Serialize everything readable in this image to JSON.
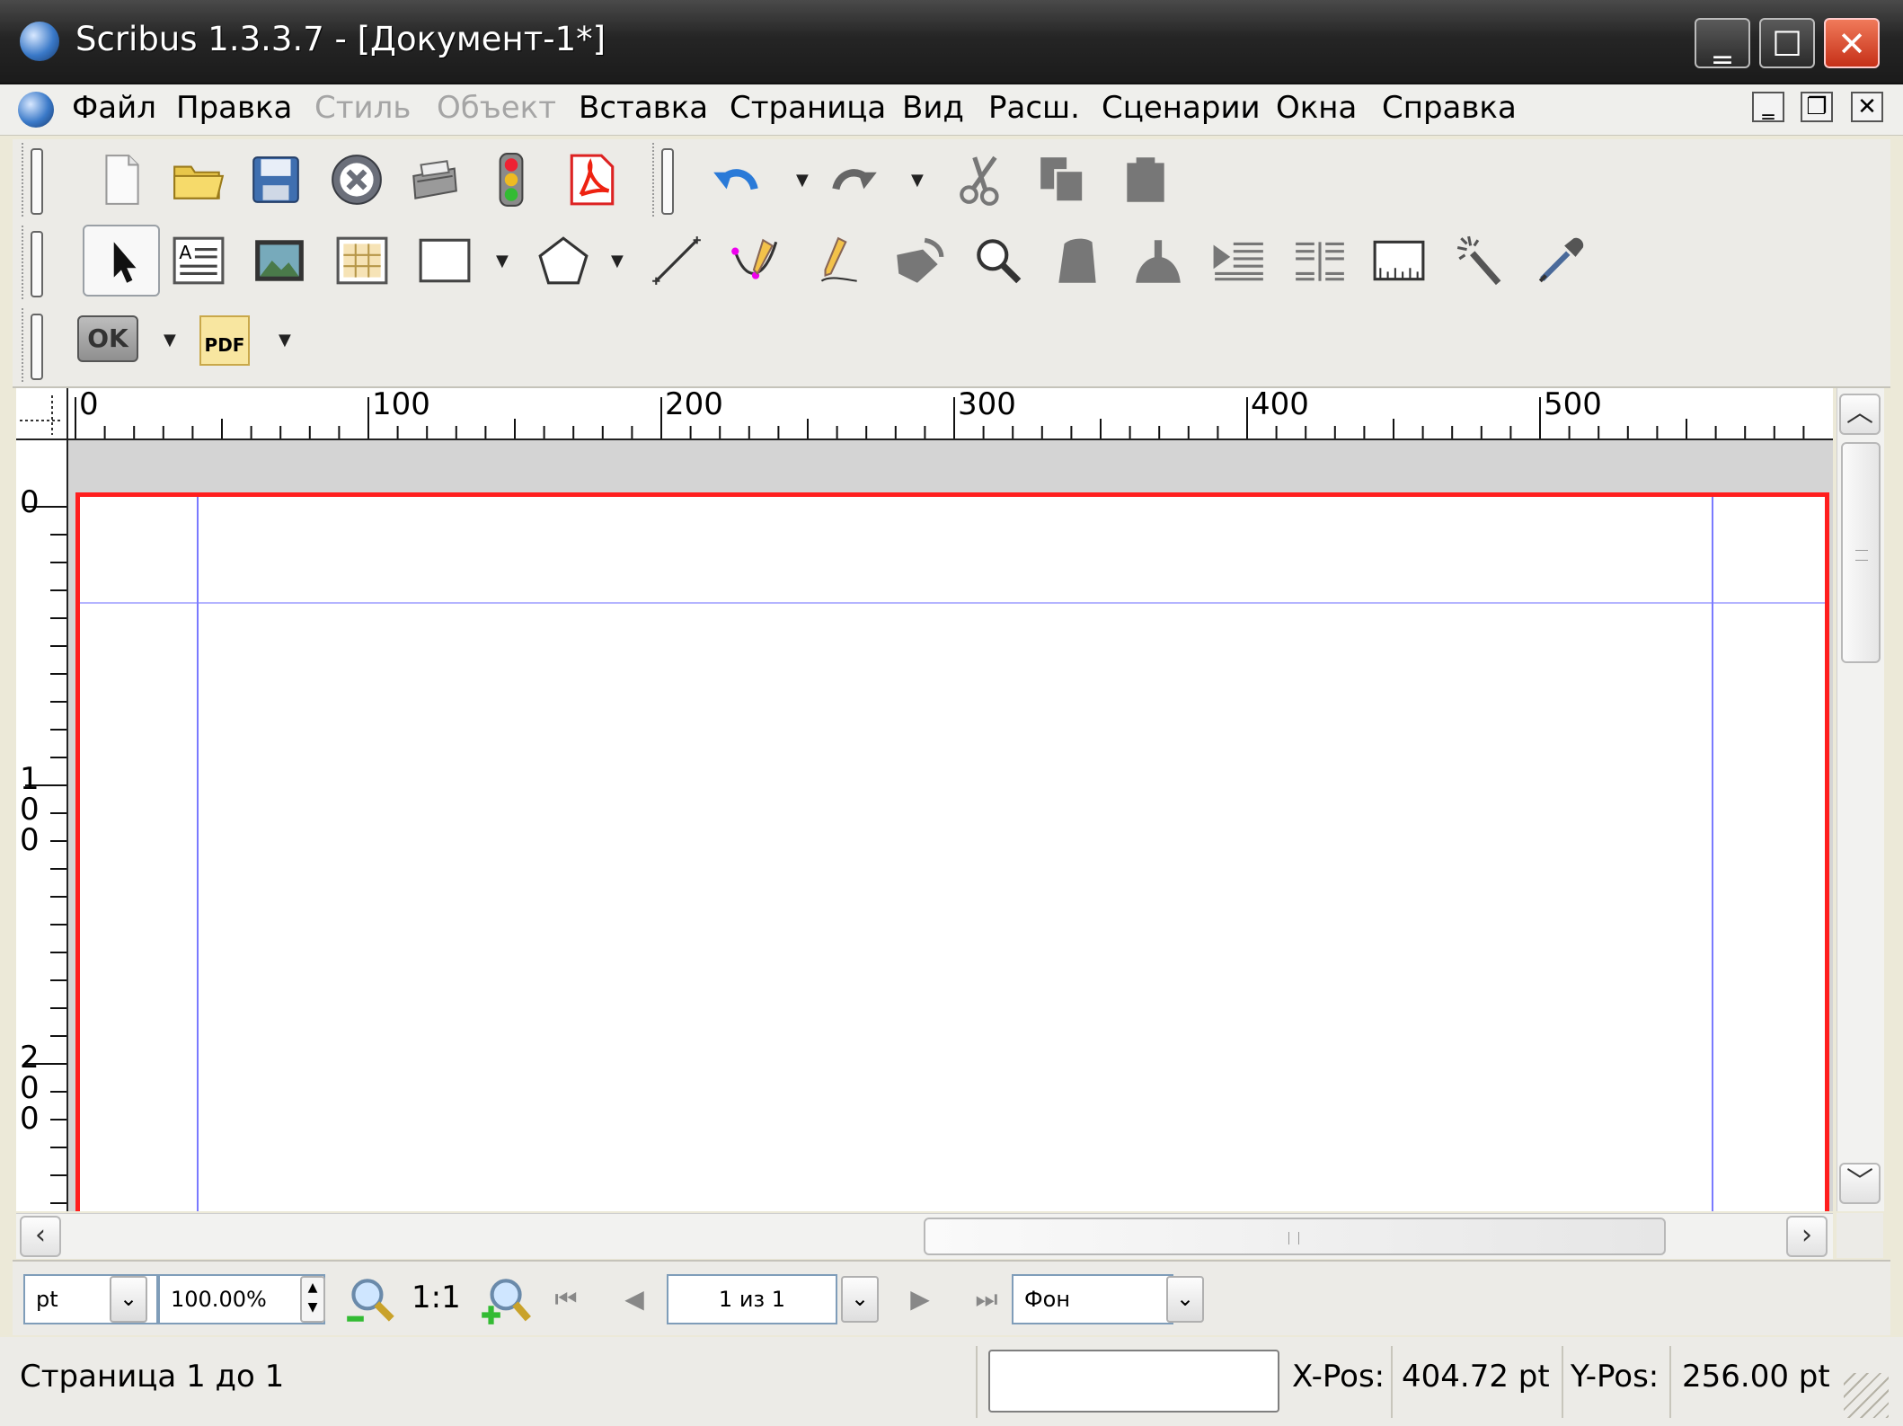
{
  "window": {
    "title": "Scribus 1.3.3.7 - [Документ-1*]",
    "controls": {
      "minimize": "‗",
      "maximize": "☐",
      "close": "✕"
    }
  },
  "menubar": {
    "items": [
      {
        "label": "Файл",
        "enabled": true
      },
      {
        "label": "Правка",
        "enabled": true
      },
      {
        "label": "Стиль",
        "enabled": false
      },
      {
        "label": "Объект",
        "enabled": false
      },
      {
        "label": "Вставка",
        "enabled": true
      },
      {
        "label": "Страница",
        "enabled": true
      },
      {
        "label": "Вид",
        "enabled": true
      },
      {
        "label": "Расш.",
        "enabled": true
      },
      {
        "label": "Сценарии",
        "enabled": true
      },
      {
        "label": "Окна",
        "enabled": true
      },
      {
        "label": "Справка",
        "enabled": true
      }
    ]
  },
  "toolbar": {
    "ok_label": "OK",
    "pdf_label": "PDF"
  },
  "rulers": {
    "horizontal_labels": [
      "0",
      "100",
      "200",
      "300",
      "400",
      "500"
    ],
    "vertical_labels": [
      "0",
      "1\n0\n0",
      "2\n0\n0"
    ]
  },
  "bottombar": {
    "unit": "pt",
    "zoom": "100.00%",
    "zoom_1to1": "1:1",
    "page": "1 из 1",
    "layer": "Фон"
  },
  "statusbar": {
    "page_info": "Страница 1 до 1",
    "xpos_label": "X-Pos:",
    "xpos_value": "404.72 pt",
    "ypos_label": "Y-Pos:",
    "ypos_value": "256.00 pt"
  },
  "colors": {
    "page_border": "#ff1e1e",
    "margin_guides": "#7a7aff",
    "titlebar": "#252525",
    "close_button": "#d83a20"
  }
}
